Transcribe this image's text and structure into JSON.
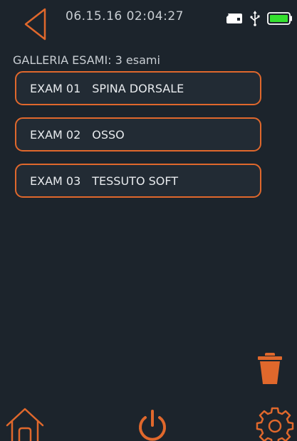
{
  "status_bar": {
    "datetime": "06.15.16  02:04:27",
    "icons": [
      "back-arrow-icon",
      "sd-card-icon",
      "usb-icon",
      "battery-icon"
    ],
    "battery_level": 1.0
  },
  "gallery": {
    "title": "GALLERIA ESAMI: 3 esami",
    "exams": [
      {
        "code": "EXAM 01",
        "name": "SPINA DORSALE"
      },
      {
        "code": "EXAM 02",
        "name": "OSSO"
      },
      {
        "code": "EXAM 03",
        "name": "TESSUTO SOFT"
      }
    ]
  },
  "toolbar": {
    "icons": [
      "trash-icon",
      "home-icon",
      "power-icon",
      "settings-gear-icon"
    ]
  },
  "colors": {
    "background": "#1c242c",
    "accent": "#e0682c",
    "text": "#e8ebee",
    "muted_text": "#c9ced3",
    "battery": "#35e02f"
  }
}
